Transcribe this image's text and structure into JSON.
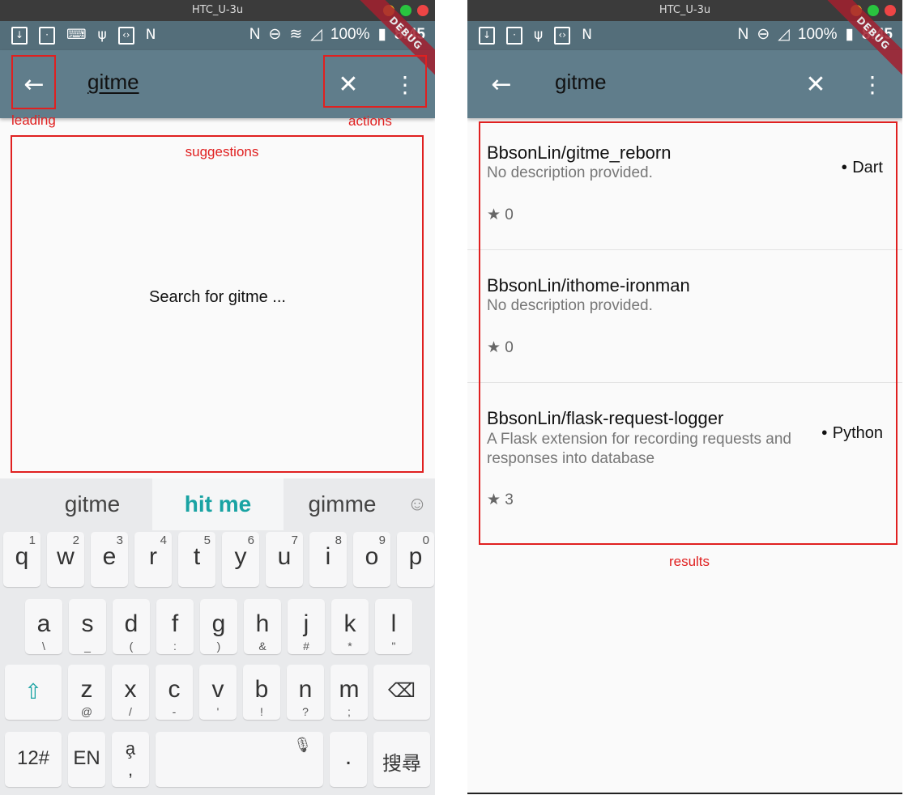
{
  "window_title": "HTC_U-3u",
  "status": {
    "battery": "100%",
    "time": "8:45"
  },
  "debug_banner": "DEBUG",
  "search": {
    "query": "gitme"
  },
  "annotations": {
    "leading": "leading",
    "actions": "actions",
    "suggestions": "suggestions",
    "results": "results"
  },
  "suggestions_hint": "Search for gitme ...",
  "keyboard": {
    "suggestions": [
      "gitme",
      "hit me",
      "gimme"
    ],
    "row1": [
      {
        "k": "q",
        "s": "1"
      },
      {
        "k": "w",
        "s": "2"
      },
      {
        "k": "e",
        "s": "3"
      },
      {
        "k": "r",
        "s": "4"
      },
      {
        "k": "t",
        "s": "5"
      },
      {
        "k": "y",
        "s": "6"
      },
      {
        "k": "u",
        "s": "7"
      },
      {
        "k": "i",
        "s": "8"
      },
      {
        "k": "o",
        "s": "9"
      },
      {
        "k": "p",
        "s": "0"
      }
    ],
    "row2": [
      {
        "k": "a",
        "s": "\\"
      },
      {
        "k": "s",
        "s": "_"
      },
      {
        "k": "d",
        "s": "("
      },
      {
        "k": "f",
        "s": ":"
      },
      {
        "k": "g",
        "s": ")"
      },
      {
        "k": "h",
        "s": "&"
      },
      {
        "k": "j",
        "s": "#"
      },
      {
        "k": "k",
        "s": "*"
      },
      {
        "k": "l",
        "s": "\""
      }
    ],
    "row3": [
      {
        "k": "z",
        "s": "@"
      },
      {
        "k": "x",
        "s": "/"
      },
      {
        "k": "c",
        "s": "-"
      },
      {
        "k": "v",
        "s": "'"
      },
      {
        "k": "b",
        "s": "!"
      },
      {
        "k": "n",
        "s": "?"
      },
      {
        "k": "m",
        "s": ";"
      }
    ],
    "num_key": "12#",
    "lang_key": "EN",
    "period_key": ".",
    "search_key": "搜尋"
  },
  "results": [
    {
      "name": "BbsonLin/gitme_reborn",
      "description": "No description provided.",
      "stars": "★ 0",
      "language": "Dart"
    },
    {
      "name": "BbsonLin/ithome-ironman",
      "description": "No description provided.",
      "stars": "★ 0",
      "language": ""
    },
    {
      "name": "BbsonLin/flask-request-logger",
      "description": "A Flask extension for recording requests and responses into database",
      "stars": "★ 3",
      "language": "Python"
    }
  ]
}
